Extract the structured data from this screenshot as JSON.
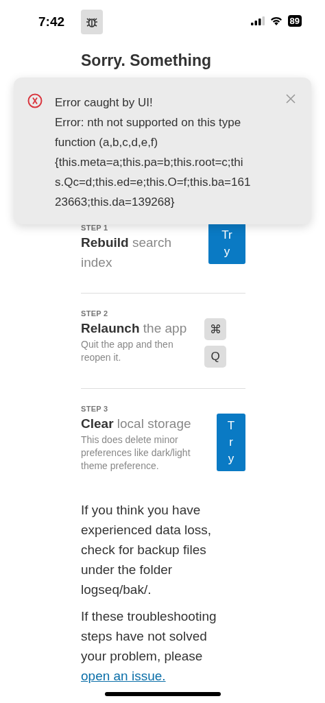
{
  "status_bar": {
    "time": "7:42",
    "battery": "89"
  },
  "heading": "Sorry. Something",
  "toast": {
    "title": "Error caught by UI!",
    "lines": [
      "Error: nth not supported on this type",
      "function (a,b,c,d,e,f)",
      "{this.meta=a;this.pa=b;this.root=c;thi",
      "s.Qc=d;this.ed=e;this.O=f;this.ba=161",
      "23663;this.da=139268}"
    ]
  },
  "steps": [
    {
      "label": "STEP 1",
      "title": "**Rebuild** search index",
      "kind": "button",
      "button": "Try"
    },
    {
      "label": "STEP 2",
      "title": "**Relaunch** the app",
      "description": "Quit the app and then reopen it.",
      "kind": "keys",
      "keys": [
        "⌘",
        "Q"
      ]
    },
    {
      "label": "STEP 3",
      "title": "**Clear** local storage",
      "description": "This does delete minor preferences like dark/light theme preference.",
      "kind": "button",
      "button": "Try"
    }
  ],
  "notes": [
    {
      "text": "If you think you have experienced data loss, check for backup files under the folder logseq/bak/."
    },
    {
      "text": "If these troubleshooting steps have not solved your problem, please",
      "link": "open an issue."
    }
  ]
}
